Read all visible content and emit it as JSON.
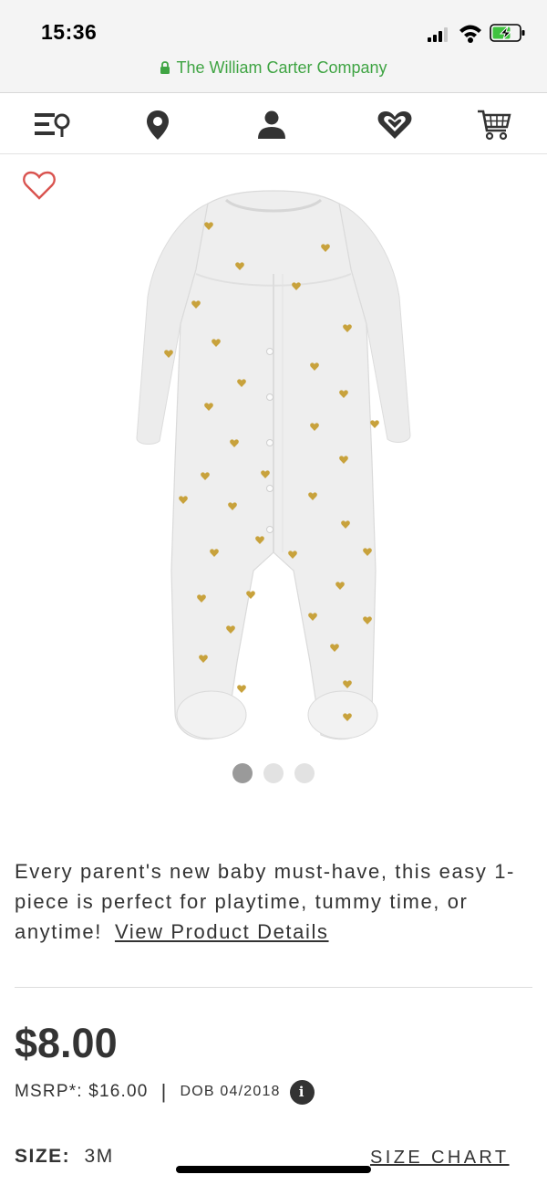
{
  "status_bar": {
    "time": "15:36",
    "signal_icon": "cellular-signal-icon",
    "wifi_icon": "wifi-icon",
    "battery_icon": "battery-charging-icon"
  },
  "browser": {
    "site_title": "The William Carter Company",
    "secure_icon": "lock-icon",
    "accent_color": "#3fa443"
  },
  "nav": {
    "items": [
      {
        "icon": "menu-search-icon"
      },
      {
        "icon": "location-pin-icon"
      },
      {
        "icon": "account-icon"
      },
      {
        "icon": "wishlist-heart-icon"
      },
      {
        "icon": "cart-icon"
      }
    ]
  },
  "product": {
    "favorite_icon": "heart-outline-icon",
    "favorite_color": "#d9534f",
    "image_icon": "baby-sleep-and-play-image",
    "carousel": {
      "count": 3,
      "active_index": 0
    },
    "description": "Every parent's new baby must-have, this easy 1-piece is perfect for playtime, tummy time, or anytime!",
    "details_link": "View Product Details",
    "price": "$8.00",
    "msrp": "MSRP*: $16.00",
    "separator": "|",
    "dob": "DOB 04/2018",
    "info_glyph": "i",
    "size_label": "SIZE:",
    "size_value": "3M",
    "size_chart_link": "SIZE CHART"
  }
}
